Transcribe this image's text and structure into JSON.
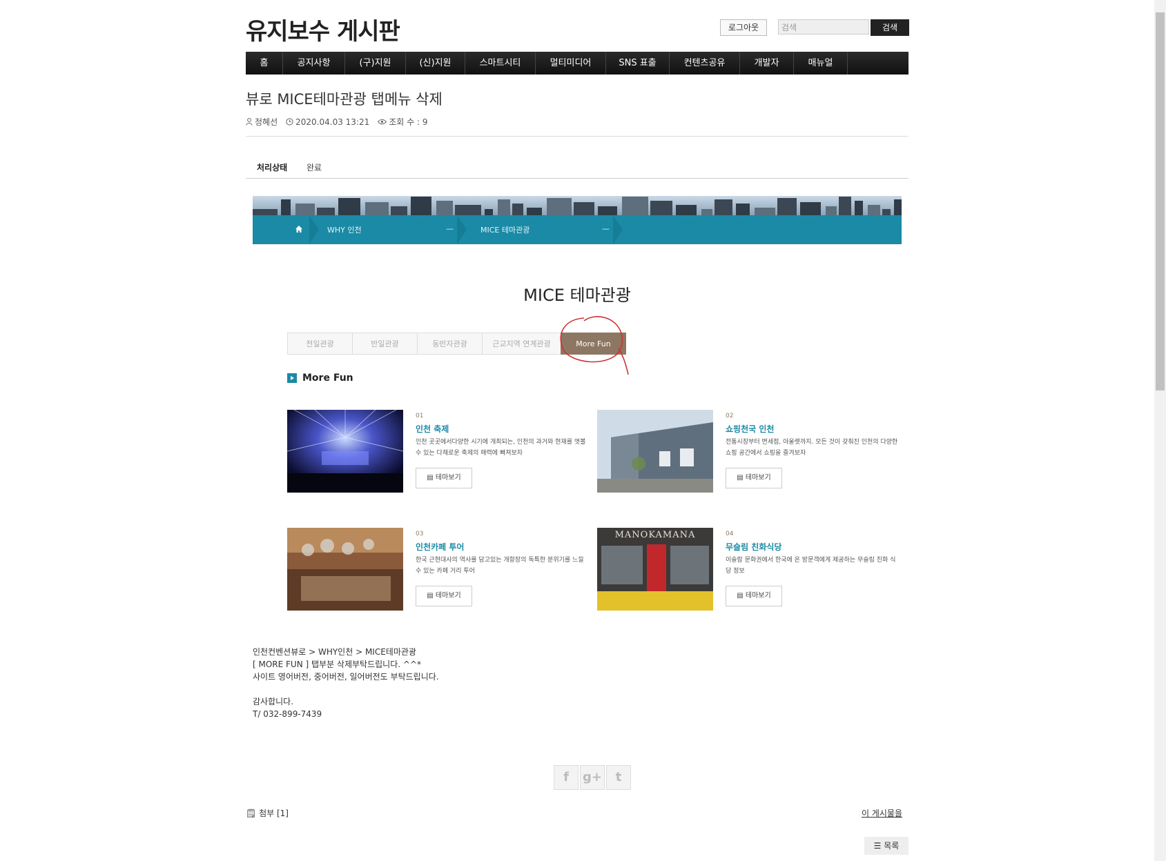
{
  "header": {
    "site_title": "유지보수 게시판",
    "logout_label": "로그아웃",
    "search_placeholder": "검색",
    "search_button": "검색"
  },
  "nav": [
    {
      "label": "홈",
      "w": 54
    },
    {
      "label": "공지사항",
      "w": 90
    },
    {
      "label": "(구)지원",
      "w": 88
    },
    {
      "label": "(신)지원",
      "w": 86
    },
    {
      "label": "스마트시티",
      "w": 102
    },
    {
      "label": "멀티미디어",
      "w": 102
    },
    {
      "label": "SNS 표출",
      "w": 92
    },
    {
      "label": "컨텐츠공유",
      "w": 102
    },
    {
      "label": "개발자",
      "w": 78
    },
    {
      "label": "매뉴얼",
      "w": 78
    }
  ],
  "post": {
    "title": "뷰로 MICE테마관광 탭메뉴 삭제",
    "author": "정혜선",
    "date": "2020.04.03 13:21",
    "views": "조회 수 : 9",
    "status_label": "처리상태",
    "status_value": "완료"
  },
  "banner": {
    "crumb1": "WHY 인천",
    "crumb2": "MICE 테마관광"
  },
  "content": {
    "section_title": "MICE 테마관광",
    "tabs": [
      {
        "label": "전일관광",
        "w": 95
      },
      {
        "label": "반일관광",
        "w": 95
      },
      {
        "label": "동반자관광",
        "w": 95
      },
      {
        "label": "근교지역 연계관광",
        "w": 115
      },
      {
        "label": "More Fun",
        "w": 95,
        "active": true
      }
    ],
    "subhead": "More Fun",
    "button_label": "테마보기",
    "cards": [
      {
        "num": "01",
        "title": "인천 축제",
        "desc": "인천 곳곳에서다양한 시기에 개최되는, 인천의 과거와 현재를 엿볼 수 있는 다채로운 축제의 매력에 빠져보자"
      },
      {
        "num": "02",
        "title": "쇼핑천국 인천",
        "desc": "전통시장부터 면세점, 아울렛까지. 모든 것이 갖춰진 인천의 다양한 쇼핑 공간에서 쇼핑을 즐겨보자"
      },
      {
        "num": "03",
        "title": "인천카페 투어",
        "desc": "한국 근현대사의 역사를 담고있는 개항장의 독특한 분위기를 느낄 수 있는 카페 거리 투어"
      },
      {
        "num": "04",
        "title": "무슬림 친화식당",
        "desc": "이슬람 문화권에서 한국에 온 방문객에게 제공하는 무슬림 친화 식당 정보"
      }
    ],
    "sign_text": "MANOKAMANA"
  },
  "body_lines": [
    "인천컨벤션뷰로 > WHY인천 > MICE테마관광",
    "[ MORE FUN ] 탭부분 삭제부탁드립니다. ^^*",
    "사이트 영어버전, 중어버전, 일어버전도 부탁드립니다.",
    "",
    "감사합니다.",
    "T/ 032-899-7439"
  ],
  "footer": {
    "attach": "첨부 [1]",
    "this_post": "이 게시물을",
    "list_button": "목록",
    "social": [
      "f",
      "g+",
      "t"
    ]
  },
  "colors": {
    "accent": "#1a8aa6",
    "tab_active": "#8d7763",
    "annotation": "#d03030"
  }
}
